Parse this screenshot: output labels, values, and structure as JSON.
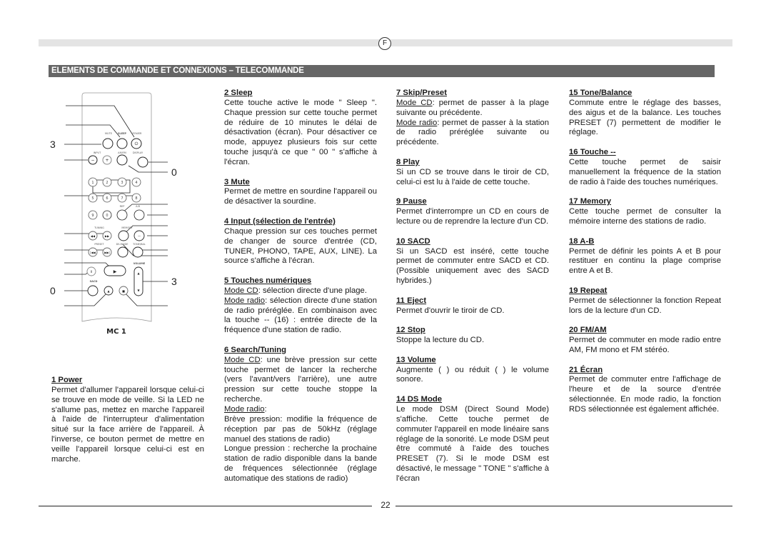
{
  "header": {
    "language_badge": "F",
    "section_title": "ELEMENTS DE COMMANDE ET CONNEXIONS – TELECOMMANDE"
  },
  "remote": {
    "model": "MC 1",
    "callout_numbers": {
      "left_3": "3",
      "right_0": "0",
      "right_3": "3",
      "left_0": "0"
    },
    "button_labels": {
      "mute": "MUTE",
      "sleep": "SLEEP",
      "power": "POWER",
      "input": "INPUT",
      "amfm": "AM/FM",
      "display": "DISPLAY",
      "rep": "REP",
      "ab": "A-B",
      "tuning": "TUNING",
      "memory": "MEMORY",
      "preset": "PRESET",
      "dsmode": "DS-MODE",
      "tonebal": "TONE/BAL",
      "volume": "VOLUME",
      "sacd": "SACD"
    },
    "digits": [
      "1",
      "2",
      "3",
      "4",
      "5",
      "6",
      "7",
      "8",
      "9",
      "0"
    ]
  },
  "entries": [
    {
      "title": "1  Power",
      "paragraphs": [
        {
          "text": "Permet d'allumer l'appareil lorsque celui-ci se trouve en mode de veille. Si la LED ne s'allume pas, mettez en marche l'appareil à l'aide de l'interrupteur d'alimentation situé sur la face arrière de l'appareil. À l'inverse, ce bouton permet de mettre en veille l'appareil lorsque celui-ci est en marche."
        }
      ]
    },
    {
      "title": "2  Sleep",
      "paragraphs": [
        {
          "text": "Cette touche active le mode \" Sleep \". Chaque pression sur cette touche permet de réduire de 10 minutes le délai de désactivation (écran). Pour désactiver ce mode, appuyez plusieurs fois sur cette touche jusqu'à ce que \" 00 \" s'affiche à l'écran."
        }
      ]
    },
    {
      "title": "3  Mute",
      "paragraphs": [
        {
          "text": "Permet de mettre en sourdine l'appareil ou de désactiver la sourdine."
        }
      ]
    },
    {
      "title": "4  Input (sélection de l'entrée)",
      "paragraphs": [
        {
          "text": "Chaque pression sur ces touches permet de changer de source d'entrée (CD, TUNER, PHONO, TAPE, AUX, LINE). La source s'affiche à l'écran."
        }
      ]
    },
    {
      "title": "5  Touches numériques",
      "paragraphs": [
        {
          "label": "Mode CD",
          "text": ": sélection directe d'une plage."
        },
        {
          "label": "Mode radio",
          "text": ": sélection directe d'une station de radio préréglée. En combinaison avec la touche -- (16) : entrée directe de la fréquence d'une station de radio."
        }
      ]
    },
    {
      "title": "6  Search/Tuning",
      "paragraphs": [
        {
          "label": "Mode CD",
          "text": ": une brève pression sur cette touche permet de lancer la recherche (vers l'avant/vers l'arrière), une autre pression sur cette touche stoppe la recherche."
        },
        {
          "label": "Mode radio",
          "text": ":"
        },
        {
          "text": "Brève pression: modifie la fréquence de réception par pas de 50kHz (réglage manuel des stations de radio)"
        },
        {
          "text": "Longue pression : recherche la prochaine station de radio disponible dans la bande de fréquences sélectionnée (réglage automatique des stations de radio)"
        }
      ]
    },
    {
      "title": "7  Skip/Preset",
      "paragraphs": [
        {
          "label": "Mode CD",
          "text": ": permet de passer à la plage suivante ou précédente."
        },
        {
          "label": "Mode radio",
          "text": ": permet de passer à la station de radio préréglée suivante ou précédente."
        }
      ]
    },
    {
      "title": "8  Play",
      "paragraphs": [
        {
          "text": "Si un CD se trouve dans le tiroir de CD, celui-ci est lu à l'aide de cette touche."
        }
      ]
    },
    {
      "title": "9  Pause",
      "paragraphs": [
        {
          "text": "Permet d'interrompre un CD en cours de lecture ou de reprendre la lecture d'un CD."
        }
      ]
    },
    {
      "title": "10  SACD",
      "paragraphs": [
        {
          "text": "Si un SACD est inséré, cette touche permet de commuter entre SACD et CD. (Possible uniquement avec des SACD hybrides.)"
        }
      ]
    },
    {
      "title": "11  Eject",
      "paragraphs": [
        {
          "text": "Permet d'ouvrir le tiroir de CD."
        }
      ]
    },
    {
      "title": "12  Stop",
      "paragraphs": [
        {
          "text": "Stoppe la lecture du CD."
        }
      ]
    },
    {
      "title": "13  Volume",
      "paragraphs": [
        {
          "text": "Augmente (    ) ou réduit (    ) le volume sonore."
        }
      ]
    },
    {
      "title": "14  DS Mode",
      "paragraphs": [
        {
          "text": "Le mode DSM (Direct Sound Mode) s'affiche. Cette touche permet de commuter l'appareil en mode linéaire sans réglage de la sonorité. Le mode DSM peut être commuté à l'aide des touches PRESET (7). Si le mode DSM est désactivé, le message \" TONE \" s'affiche à l'écran"
        }
      ]
    },
    {
      "title": "15 Tone/Balance",
      "paragraphs": [
        {
          "text": "Commute entre le réglage des basses, des aigus et de la balance. Les touches PRESET (7) permettent de modifier le réglage."
        }
      ]
    },
    {
      "title": "16  Touche --",
      "paragraphs": [
        {
          "text": "Cette touche permet de saisir manuellement la fréquence de la station de radio à l'aide des touches numériques."
        }
      ]
    },
    {
      "title": "17  Memory",
      "paragraphs": [
        {
          "text": "Cette touche permet de consulter la mémoire interne des stations de radio."
        }
      ]
    },
    {
      "title": "18  A-B",
      "paragraphs": [
        {
          "text": "Permet de définir les points A et B pour restituer en continu la plage comprise entre A et B."
        }
      ]
    },
    {
      "title": "19  Repeat",
      "paragraphs": [
        {
          "text": "Permet de sélectionner la fonction Repeat lors de la lecture d'un CD."
        }
      ]
    },
    {
      "title": "20  FM/AM",
      "paragraphs": [
        {
          "text": "Permet de commuter en mode radio entre AM, FM mono et FM stéréo."
        }
      ]
    },
    {
      "title": "21  Écran",
      "paragraphs": [
        {
          "text": "Permet de commuter entre l'affichage de l'heure et de la source d'entrée sélectionnée. En mode radio, la fonction RDS sélectionnée est également affichée."
        }
      ]
    }
  ],
  "columns": [
    [
      0
    ],
    [
      1,
      2,
      3,
      4,
      5
    ],
    [
      6,
      7,
      8,
      9,
      10,
      11,
      12,
      13
    ],
    [
      14,
      15,
      16,
      17,
      18,
      19,
      20
    ]
  ],
  "footer": {
    "page_number": "22"
  }
}
